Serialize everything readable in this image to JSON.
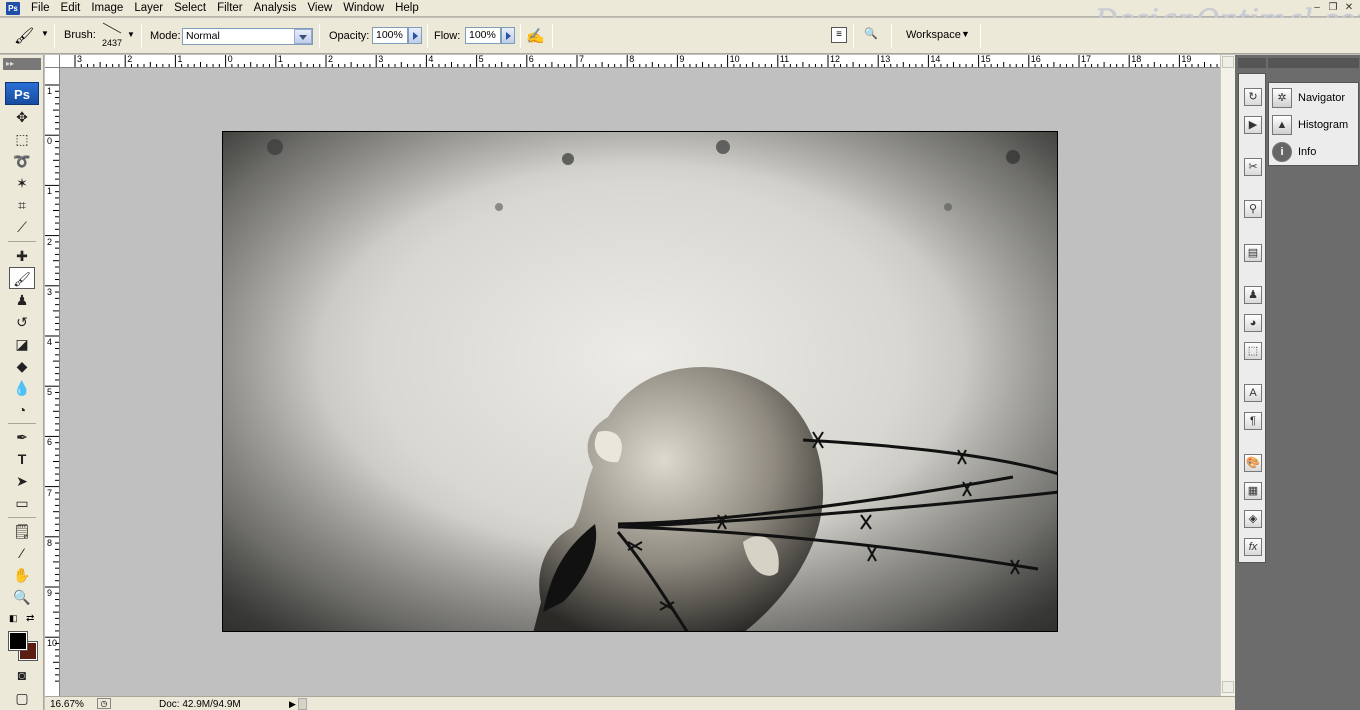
{
  "menubar": {
    "app_icon": "Ps",
    "items": [
      "File",
      "Edit",
      "Image",
      "Layer",
      "Select",
      "Filter",
      "Analysis",
      "View",
      "Window",
      "Help"
    ],
    "watermark": "DesignOptimal.com"
  },
  "options": {
    "brush_label": "Brush:",
    "brush_size": "2437",
    "mode_label": "Mode:",
    "mode_value": "Normal",
    "opacity_label": "Opacity:",
    "opacity_value": "100%",
    "flow_label": "Flow:",
    "flow_value": "100%",
    "workspace_label": "Workspace"
  },
  "toolbar": {
    "logo": "Ps",
    "tools": [
      "move-icon",
      "marquee-icon",
      "lasso-icon",
      "magic-wand-icon",
      "crop-icon",
      "slice-icon",
      "healing-brush-icon",
      "brush-icon",
      "clone-stamp-icon",
      "history-brush-icon",
      "eraser-icon",
      "paint-bucket-icon",
      "blur-icon",
      "dodge-icon",
      "pen-icon",
      "type-icon",
      "path-selection-icon",
      "shape-icon",
      "notes-icon",
      "eyedropper-icon",
      "hand-icon",
      "zoom-icon"
    ],
    "active_tool": "brush-icon",
    "foreground_color": "#000000",
    "background_color": "#5a1d10"
  },
  "rulers": {
    "top": [
      "3",
      "2",
      "1",
      "0",
      "1",
      "2",
      "3",
      "4",
      "5",
      "6",
      "7",
      "8",
      "9",
      "10",
      "11",
      "12",
      "13",
      "14",
      "15",
      "16",
      "17",
      "18",
      "19"
    ],
    "left": [
      "1",
      "0",
      "1",
      "2",
      "3",
      "4",
      "5",
      "6",
      "7",
      "8",
      "9",
      "10"
    ]
  },
  "status": {
    "zoom": "16.67%",
    "doc_size": "Doc: 42.9M/94.9M"
  },
  "panels": {
    "items": [
      "Navigator",
      "Histogram",
      "Info"
    ]
  }
}
